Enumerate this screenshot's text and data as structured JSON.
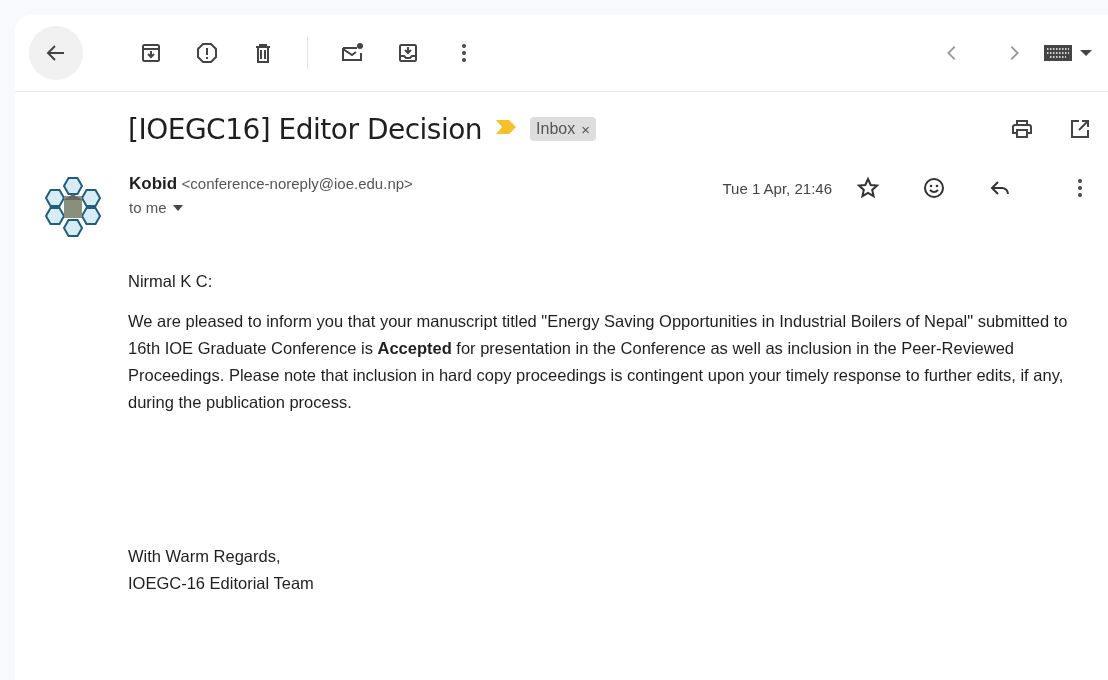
{
  "message": {
    "subject": "[IOEGC16] Editor Decision",
    "important": true,
    "labels": [
      {
        "text": "Inbox",
        "removable": "×"
      }
    ],
    "sender": {
      "name": "Kobid",
      "email": "<conference-noreply@ioe.edu.np>",
      "recipient": "to me"
    },
    "date": "Tue 1 Apr, 21:46",
    "body": {
      "greeting": "Nirmal K C:",
      "paragraph": "We are pleased to inform you that your manuscript titled \"Energy Saving Opportunities in Industrial Boilers of Nepal\" submitted to 16th IOE Graduate Conference is **Accepted** for presentation in the Conference as well as inclusion in the Peer-Reviewed Proceedings. Please note that inclusion in hard copy proceedings is contingent upon your timely response to further edits, if any, during the publication process.",
      "signoff": [
        "With Warm Regards,",
        "IOEGC-16 Editorial Team"
      ]
    }
  }
}
